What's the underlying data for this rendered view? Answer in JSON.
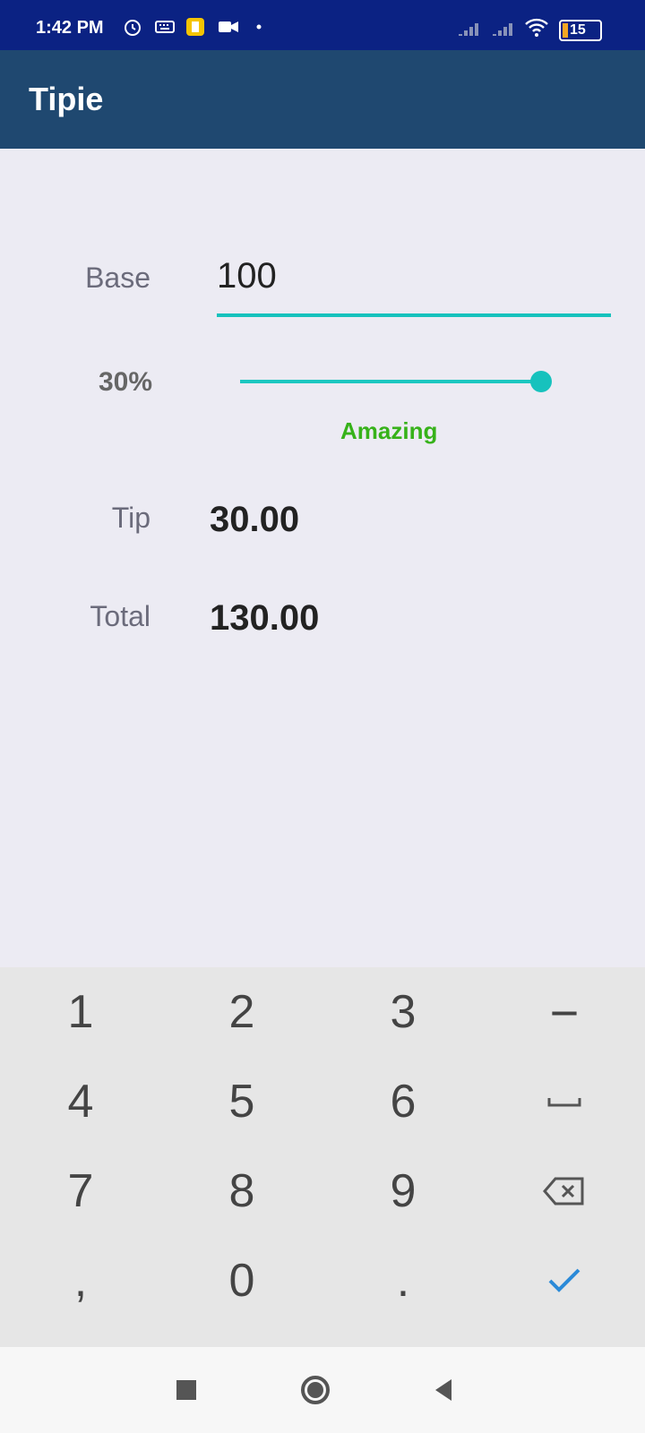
{
  "status_bar": {
    "time": "1:42 PM",
    "battery": "15",
    "icons": [
      "alarm-icon",
      "keyboard-icon",
      "app-icon",
      "video-icon",
      "dot-icon",
      "signal-icon",
      "signal-icon",
      "wifi-icon",
      "battery-icon"
    ]
  },
  "app": {
    "title": "Tipie"
  },
  "form": {
    "base_label": "Base",
    "base_value": "100",
    "tip_percent": "30%",
    "tip_description": "Amazing",
    "tip_label": "Tip",
    "tip_value": "30.00",
    "total_label": "Total",
    "total_value": "130.00"
  },
  "keyboard": {
    "keys": [
      [
        "1",
        "2",
        "3",
        "−"
      ],
      [
        "4",
        "5",
        "6",
        "space"
      ],
      [
        "7",
        "8",
        "9",
        "backspace"
      ],
      [
        ",",
        "0",
        ".",
        "done"
      ]
    ]
  },
  "colors": {
    "accent": "#17c2bd",
    "appbar": "#1f4870",
    "statusbar": "#0b2283",
    "description": "#37b21a"
  }
}
